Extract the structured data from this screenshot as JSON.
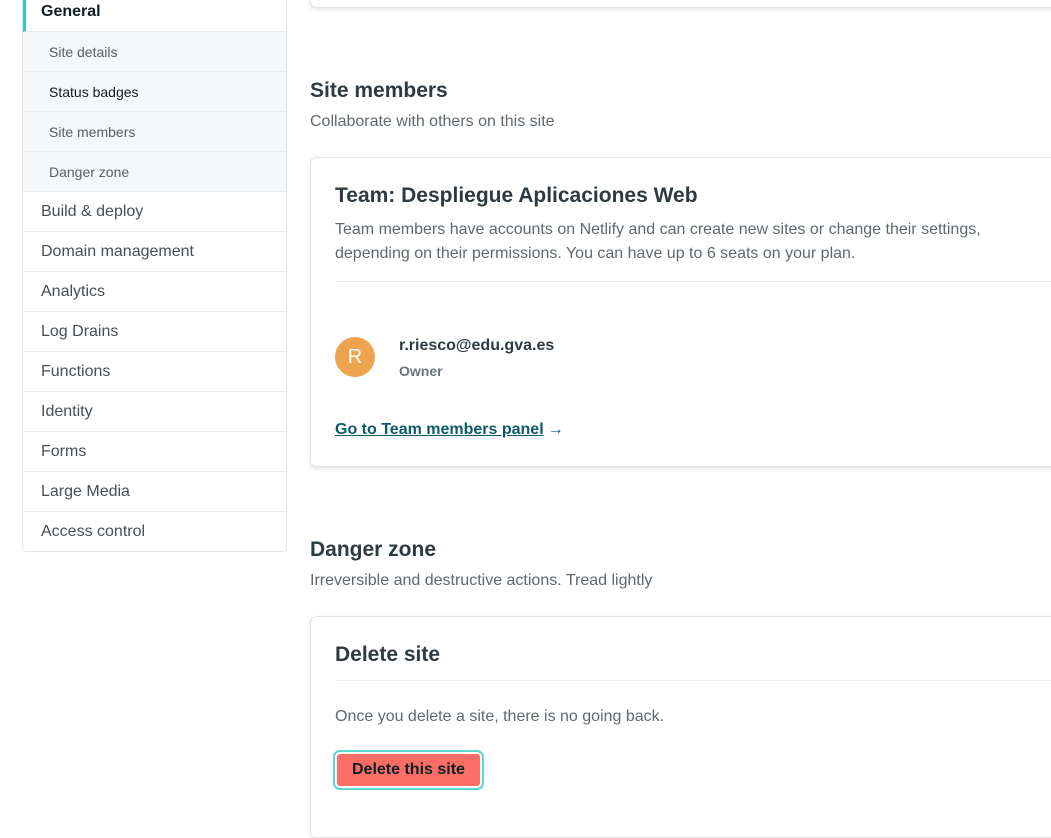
{
  "sidebar": {
    "general": "General",
    "sub_items": [
      "Site details",
      "Status badges",
      "Site members",
      "Danger zone"
    ],
    "items": [
      "Build & deploy",
      "Domain management",
      "Analytics",
      "Log Drains",
      "Functions",
      "Identity",
      "Forms",
      "Large Media",
      "Access control"
    ]
  },
  "site_members": {
    "title": "Site members",
    "description": "Collaborate with others on this site",
    "team_title": "Team: Despliegue Aplicaciones Web",
    "team_text": "Team members have accounts on Netlify and can create new sites or change their settings, depending on their permissions. You can have up to 6 seats on your plan.",
    "member": {
      "initial": "R",
      "email": "r.riesco@edu.gva.es",
      "role": "Owner",
      "avatar_color": "#eea34e"
    },
    "link_label": "Go to Team members panel",
    "link_arrow": "→"
  },
  "danger_zone": {
    "title": "Danger zone",
    "description": "Irreversible and destructive actions. Tread lightly",
    "card_title": "Delete site",
    "text": "Once you delete a site, there is no going back.",
    "button_label": "Delete this site",
    "button_color": "#fb6d65"
  }
}
